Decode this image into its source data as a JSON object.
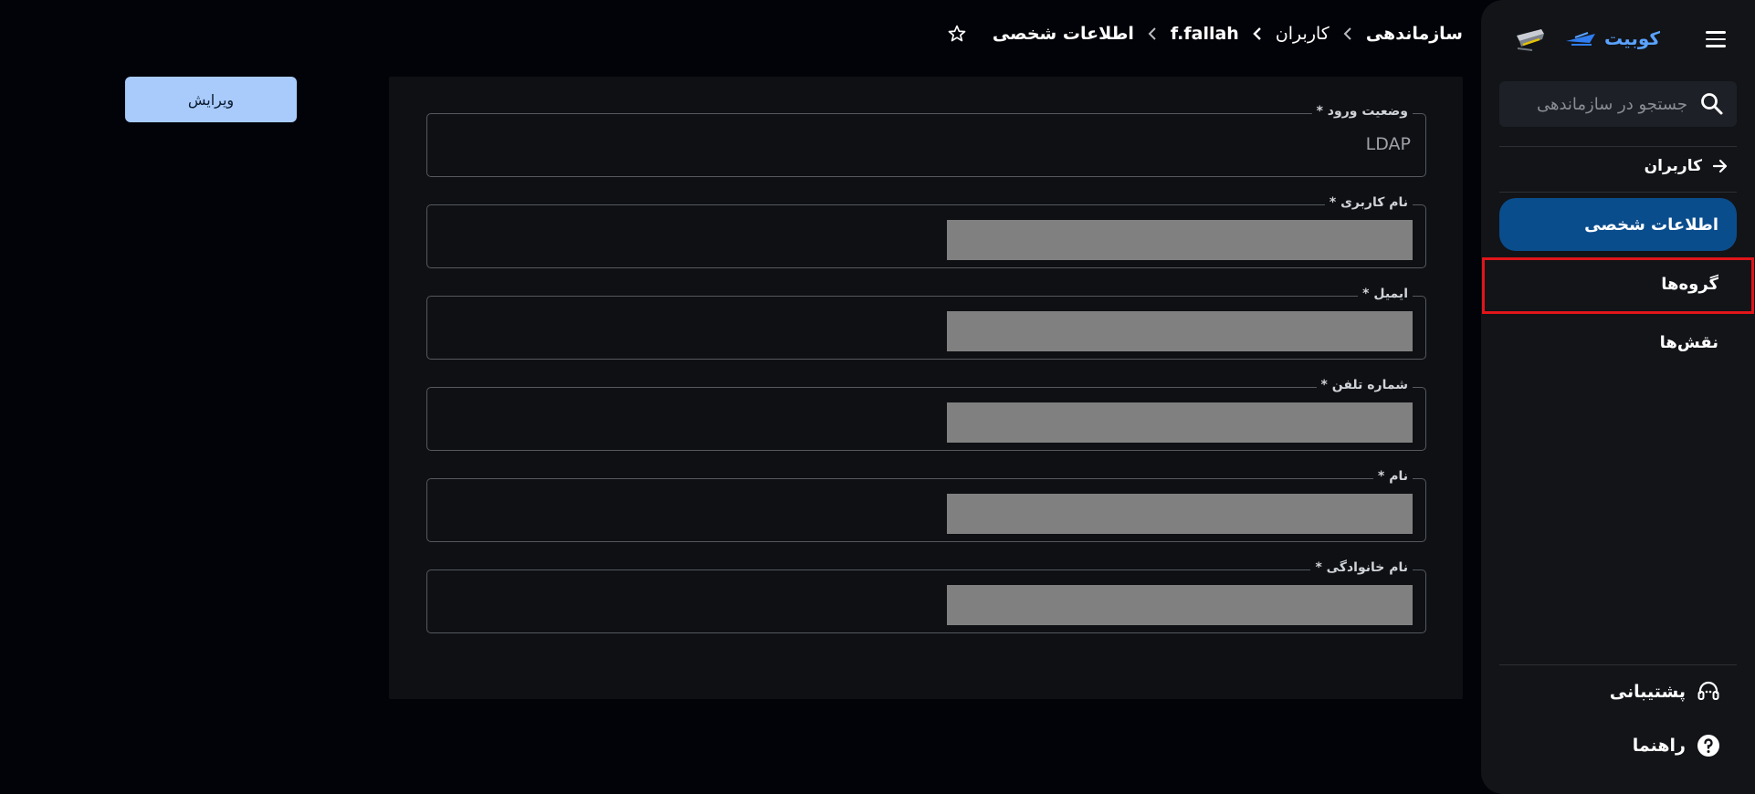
{
  "sidebar": {
    "brand_name": "کوبیت",
    "search_placeholder": "جستجو در سازماندهی",
    "back_label": "کاربران",
    "items": [
      {
        "label": "اطلاعات شخصی",
        "active": true
      },
      {
        "label": "گروه‌ها",
        "active": false
      },
      {
        "label": "نقش‌ها",
        "active": false
      }
    ],
    "support_label": "پشتیبانی",
    "help_label": "راهنما",
    "colors": {
      "active_bg": "#0a4d8d",
      "highlight": "#e0151a",
      "brand": "#5aa2ff"
    }
  },
  "breadcrumb": {
    "items": [
      "سازماندهی",
      "کاربران",
      "f.fallah",
      "اطلاعات شخصی"
    ]
  },
  "toolbar": {
    "edit_label": "ویرایش"
  },
  "form": {
    "fields": [
      {
        "label": "وضعیت ورود *",
        "value": "LDAP"
      },
      {
        "label": "نام کاربری *",
        "value": ""
      },
      {
        "label": "ایمیل *",
        "value": ""
      },
      {
        "label": "شماره تلفن *",
        "value": ""
      },
      {
        "label": "نام *",
        "value": ""
      },
      {
        "label": "نام خانوادگی *",
        "value": ""
      }
    ]
  }
}
